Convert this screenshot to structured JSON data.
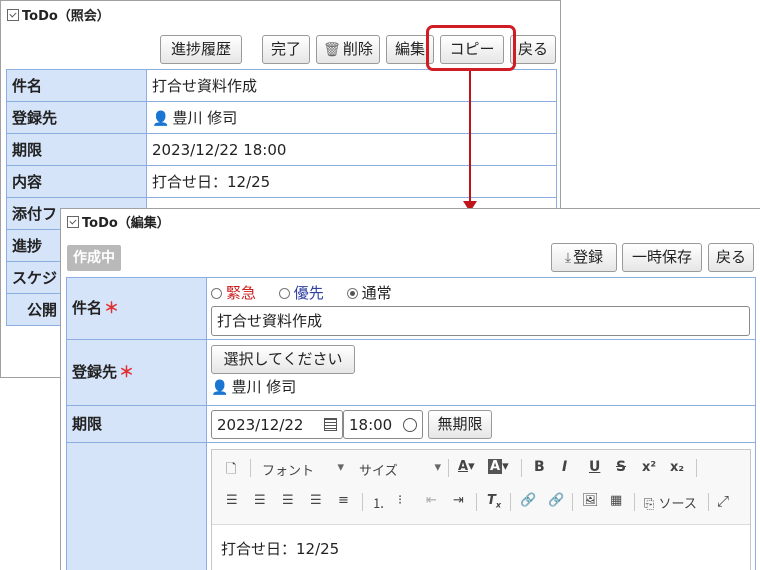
{
  "back_panel": {
    "title": "ToDo（照会）",
    "buttons": {
      "history": "進捗履歴",
      "complete": "完了",
      "delete": "削除",
      "edit": "編集",
      "copy": "コピー",
      "back": "戻る"
    },
    "rows": {
      "subject": {
        "label": "件名",
        "value": "打合せ資料作成"
      },
      "assignee": {
        "label": "登録先",
        "value": "豊川 修司"
      },
      "due": {
        "label": "期限",
        "value": "2023/12/22 18:00"
      },
      "content": {
        "label": "内容",
        "value": "打合せ日：12/25"
      },
      "attachment": {
        "label": "添付フ"
      },
      "progress": {
        "label": "進捗"
      },
      "schedule": {
        "label": "スケジ"
      },
      "public": {
        "label": "公開"
      }
    }
  },
  "front_panel": {
    "title": "ToDo（編集）",
    "status_badge": "作成中",
    "buttons": {
      "register": "登録",
      "temp_save": "一時保存",
      "back": "戻る"
    },
    "subject": {
      "label": "件名",
      "required_mark": "＊",
      "priorities": {
        "urgent": "緊急",
        "priority": "優先",
        "normal": "通常"
      },
      "selected_priority": "通常",
      "value": "打合せ資料作成"
    },
    "assignee": {
      "label": "登録先",
      "required_mark": "＊",
      "select_button": "選択してください",
      "person": "豊川 修司"
    },
    "due": {
      "label": "期限",
      "date": "2023/12/22",
      "time": "18:00",
      "no_limit_button": "無期限"
    },
    "editor": {
      "font_label": "フォント",
      "size_label": "サイズ",
      "source_label": "ソース",
      "bold": "B",
      "italic": "I",
      "underline": "U",
      "strike": "S",
      "superscript": "x²",
      "subscript": "x₂",
      "text_color": "A",
      "bg_color": "A",
      "content": "打合せ日：12/25"
    }
  },
  "colors": {
    "label_bg": "#d6e4fa",
    "border": "#8caee0",
    "highlight": "#d01c24",
    "urgent": "#cc2020",
    "priority": "#2e3fa0"
  }
}
